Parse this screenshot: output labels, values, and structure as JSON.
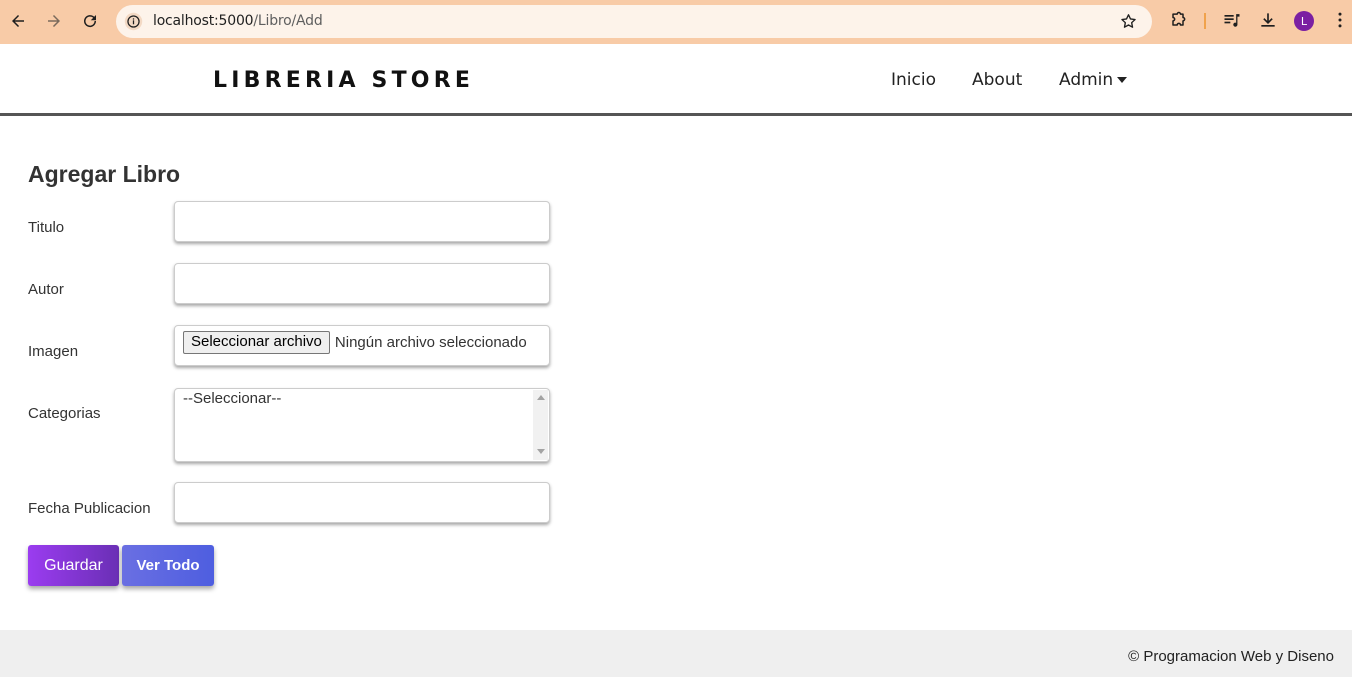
{
  "browser": {
    "url_host": "localhost:5000",
    "url_path": "/Libro/Add",
    "avatar_letter": "L"
  },
  "header": {
    "brand": "LIBRERIA STORE",
    "nav": {
      "inicio": "Inicio",
      "about": "About",
      "admin": "Admin"
    }
  },
  "form": {
    "title": "Agregar Libro",
    "fields": {
      "titulo_label": "Titulo",
      "titulo_value": "",
      "autor_label": "Autor",
      "autor_value": "",
      "imagen_label": "Imagen",
      "file_button": "Seleccionar archivo",
      "file_status": "Ningún archivo seleccionado",
      "categorias_label": "Categorias",
      "categorias_option": "--Seleccionar--",
      "fecha_label": "Fecha Publicacion",
      "fecha_value": ""
    },
    "buttons": {
      "save": "Guardar",
      "view_all": "Ver Todo"
    }
  },
  "footer": {
    "text": "© Programacion Web y Diseno"
  },
  "colors": {
    "browser_bar": "#f8cba7",
    "save_button": "#9b3cf0",
    "view_all_button": "#5a66e1",
    "footer_bg": "#efefef"
  }
}
